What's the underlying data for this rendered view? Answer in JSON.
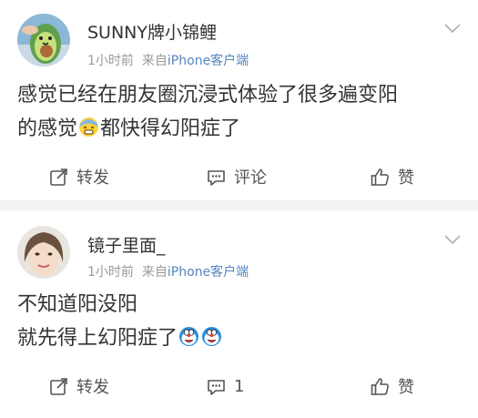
{
  "posts": [
    {
      "username": "SUNNY牌小锦鲤",
      "time": "1小时前",
      "source_prefix": "来自",
      "source": "iPhone客户端",
      "text_line1": "感觉已经在朋友圈沉浸式体验了很多遍变阳",
      "text_line2_pre": "的感觉",
      "text_line2_post": "都快得幻阳症了",
      "emoji": "sweating-face-emoji",
      "repost_label": "转发",
      "comment_label": "评论",
      "like_label": "赞"
    },
    {
      "username": "镜子里面_",
      "time": "1小时前",
      "source_prefix": "来自",
      "source": "iPhone客户端",
      "text_line1": "不知道阳没阳",
      "text_line2_pre": "就先得上幻阳症了",
      "emoji": "doraemon-emoji",
      "repost_label": "转发",
      "comment_label": "1",
      "like_label": "赞"
    }
  ],
  "colors": {
    "background": "#f2f2f2",
    "card": "#ffffff",
    "text": "#333333",
    "meta": "#999999",
    "source_link": "#5585bf"
  },
  "icons": [
    "chevron-down-icon",
    "repost-icon",
    "comment-icon",
    "like-icon"
  ]
}
